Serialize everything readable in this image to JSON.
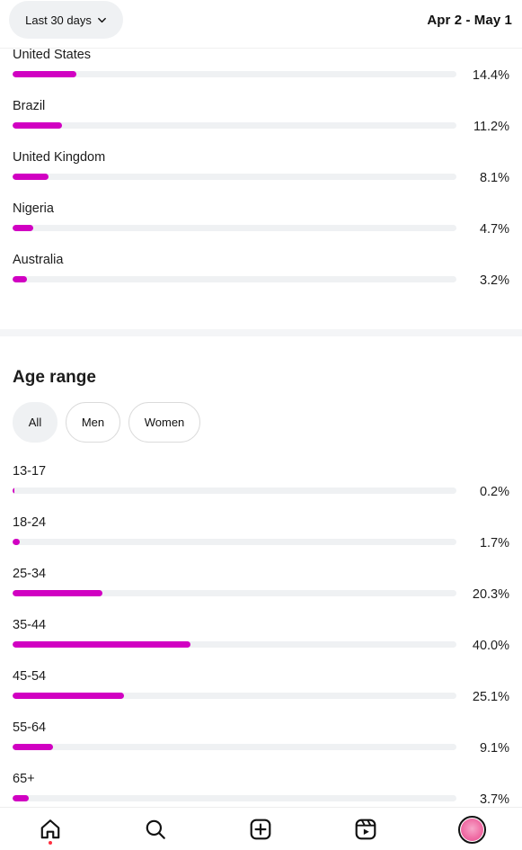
{
  "header": {
    "range_label": "Last 30 days",
    "date_range": "Apr 2 - May 1"
  },
  "locations": [
    {
      "label": "United States",
      "pct": "14.4%",
      "value": 14.4
    },
    {
      "label": "Brazil",
      "pct": "11.2%",
      "value": 11.2
    },
    {
      "label": "United Kingdom",
      "pct": "8.1%",
      "value": 8.1
    },
    {
      "label": "Nigeria",
      "pct": "4.7%",
      "value": 4.7
    },
    {
      "label": "Australia",
      "pct": "3.2%",
      "value": 3.2
    }
  ],
  "age_section": {
    "title": "Age range",
    "filters": [
      {
        "label": "All",
        "selected": true
      },
      {
        "label": "Men",
        "selected": false
      },
      {
        "label": "Women",
        "selected": false
      }
    ],
    "ranges": [
      {
        "label": "13-17",
        "pct": "0.2%",
        "value": 0.2
      },
      {
        "label": "18-24",
        "pct": "1.7%",
        "value": 1.7
      },
      {
        "label": "25-34",
        "pct": "20.3%",
        "value": 20.3
      },
      {
        "label": "35-44",
        "pct": "40.0%",
        "value": 40.0
      },
      {
        "label": "45-54",
        "pct": "25.1%",
        "value": 25.1
      },
      {
        "label": "55-64",
        "pct": "9.1%",
        "value": 9.1
      },
      {
        "label": "65+",
        "pct": "3.7%",
        "value": 3.7
      }
    ]
  },
  "colors": {
    "bar_fill": "#d100c2",
    "bar_track": "#eff1f3",
    "notification_dot": "#ff3040"
  },
  "navbar": {
    "items": [
      "home-icon",
      "search-icon",
      "create-icon",
      "reels-icon",
      "profile-avatar"
    ]
  }
}
